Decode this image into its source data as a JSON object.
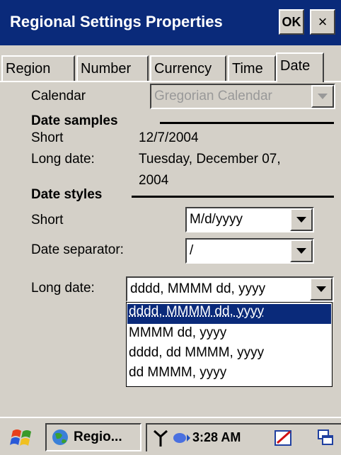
{
  "window": {
    "title": "Regional Settings Properties",
    "ok_label": "OK",
    "close_label": "×"
  },
  "tabs": [
    "Region",
    "Number",
    "Currency",
    "Time",
    "Date"
  ],
  "active_tab": "Date",
  "calendar": {
    "label": "Calendar",
    "value": "Gregorian Calendar"
  },
  "date_samples": {
    "heading": "Date samples",
    "short_label": "Short",
    "short_value": "12/7/2004",
    "long_label": "Long date:",
    "long_value_line1": "Tuesday, December 07,",
    "long_value_line2": "2004"
  },
  "date_styles": {
    "heading": "Date styles",
    "short_label": "Short",
    "short_value": "M/d/yyyy",
    "separator_label": "Date separator:",
    "separator_value": "/",
    "long_label": "Long date:",
    "long_value": "dddd, MMMM dd, yyyy",
    "long_options": [
      "dddd, MMMM dd, yyyy",
      "MMMM dd, yyyy",
      "dddd, dd MMMM, yyyy",
      "dd MMMM, yyyy"
    ],
    "selected_option_index": 0
  },
  "taskbar": {
    "task_label": "Regio...",
    "clock": "3:28 AM"
  },
  "colors": {
    "titlebar": "#0a2a7a",
    "face": "#d4d0c8",
    "selection": "#0a2a7a"
  }
}
